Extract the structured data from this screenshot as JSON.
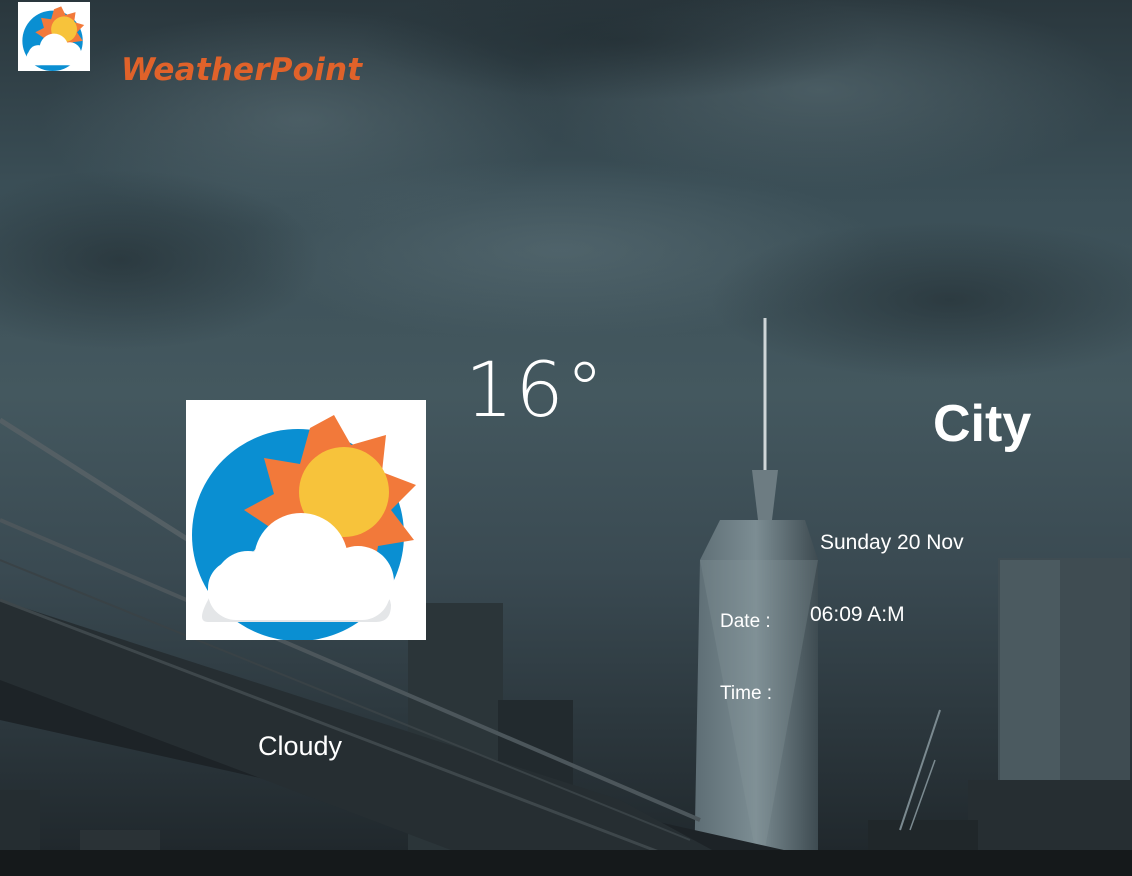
{
  "app": {
    "name": "WeatherPoint",
    "logo_icon": "partly-cloudy-icon"
  },
  "weather": {
    "temperature": "16°",
    "city": "City",
    "condition": "Cloudy",
    "condition_icon": "partly-cloudy-icon"
  },
  "details": {
    "day_date": "Sunday 20 Nov",
    "date_label": "Date :",
    "time_value": "06:09 A:M",
    "time_label": "Time :"
  },
  "colors": {
    "brand": "#e0622a",
    "icon_blue": "#0a8fd2",
    "icon_sun_rays": "#f2793a",
    "icon_sun_core": "#f7c33b",
    "text": "#ffffff"
  }
}
